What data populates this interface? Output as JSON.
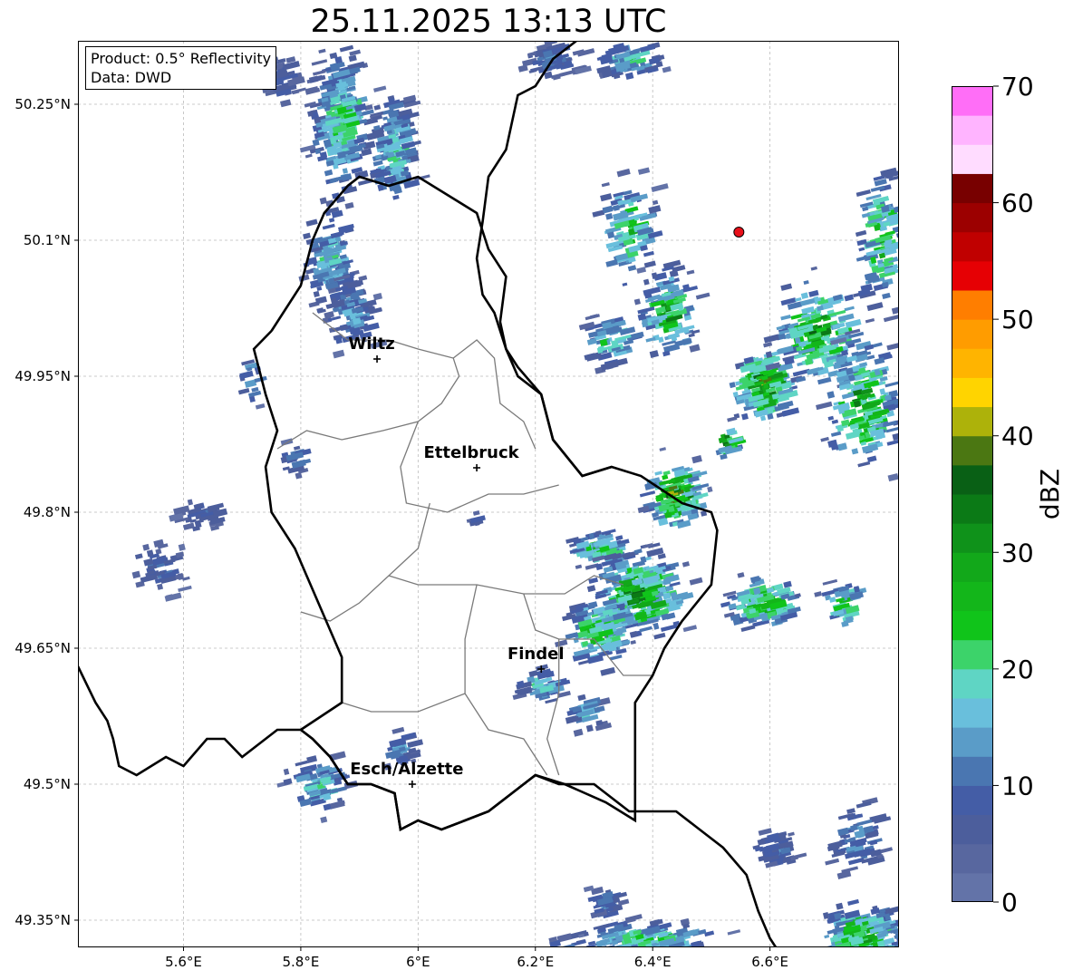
{
  "title": "25.11.2025 13:13 UTC",
  "info_box": {
    "product": "Product: 0.5° Reflectivity",
    "data": "Data: DWD"
  },
  "map": {
    "extent": {
      "lon": [
        5.42,
        6.82
      ],
      "lat": [
        49.32,
        50.32
      ]
    },
    "lat_ticks": [
      {
        "v": 49.35,
        "label": "49.35°N"
      },
      {
        "v": 49.5,
        "label": "49.5°N"
      },
      {
        "v": 49.65,
        "label": "49.65°N"
      },
      {
        "v": 49.8,
        "label": "49.8°N"
      },
      {
        "v": 49.95,
        "label": "49.95°N"
      },
      {
        "v": 50.1,
        "label": "50.1°N"
      },
      {
        "v": 50.25,
        "label": "50.25°N"
      }
    ],
    "lon_ticks": [
      {
        "v": 5.6,
        "label": "5.6°E"
      },
      {
        "v": 5.8,
        "label": "5.8°E"
      },
      {
        "v": 6.0,
        "label": "6°E"
      },
      {
        "v": 6.2,
        "label": "6.2°E"
      },
      {
        "v": 6.4,
        "label": "6.4°E"
      },
      {
        "v": 6.6,
        "label": "6.6°E"
      }
    ],
    "gridlines": true,
    "cities": [
      {
        "name": "Wiltz",
        "lon": 5.93,
        "lat": 49.969
      },
      {
        "name": "Ettelbruck",
        "lon": 6.1,
        "lat": 49.849
      },
      {
        "name": "Findel",
        "lon": 6.21,
        "lat": 49.627
      },
      {
        "name": "Esch/Alzette",
        "lon": 5.99,
        "lat": 49.5
      }
    ],
    "radar_site": {
      "lon": 6.547,
      "lat": 50.109,
      "color": "#e8101a"
    },
    "border": [
      [
        5.42,
        49.63
      ],
      [
        5.45,
        49.59
      ],
      [
        5.47,
        49.57
      ],
      [
        5.48,
        49.55
      ],
      [
        5.49,
        49.52
      ],
      [
        5.52,
        49.51
      ],
      [
        5.57,
        49.53
      ],
      [
        5.6,
        49.52
      ],
      [
        5.64,
        49.55
      ],
      [
        5.67,
        49.55
      ],
      [
        5.7,
        49.53
      ],
      [
        5.76,
        49.56
      ],
      [
        5.8,
        49.56
      ],
      [
        5.82,
        49.55
      ],
      [
        5.85,
        49.53
      ],
      [
        5.88,
        49.5
      ],
      [
        5.92,
        49.5
      ],
      [
        5.96,
        49.49
      ],
      [
        5.97,
        49.45
      ],
      [
        6.0,
        49.46
      ],
      [
        6.04,
        49.45
      ],
      [
        6.08,
        49.46
      ],
      [
        6.12,
        49.47
      ],
      [
        6.16,
        49.49
      ],
      [
        6.2,
        49.51
      ],
      [
        6.24,
        49.5
      ],
      [
        6.3,
        49.5
      ],
      [
        6.36,
        49.47
      ],
      [
        6.38,
        49.47
      ],
      [
        6.4,
        49.47
      ],
      [
        6.44,
        49.47
      ],
      [
        6.48,
        49.45
      ],
      [
        6.52,
        49.43
      ],
      [
        6.56,
        49.4
      ],
      [
        6.58,
        49.36
      ],
      [
        6.6,
        49.33
      ],
      [
        6.62,
        49.31
      ]
    ],
    "border_north": [
      [
        5.81,
        50.16
      ],
      [
        5.84,
        50.13
      ],
      [
        5.86,
        50.11
      ],
      [
        5.88,
        50.08
      ],
      [
        5.9,
        50.05
      ],
      [
        5.92,
        50.02
      ],
      [
        5.95,
        49.98
      ],
      [
        5.97,
        49.96
      ],
      [
        6.0,
        49.95
      ],
      [
        6.02,
        49.93
      ],
      [
        6.05,
        49.92
      ],
      [
        6.08,
        49.89
      ],
      [
        6.1,
        49.86
      ],
      [
        6.12,
        49.84
      ],
      [
        6.16,
        49.83
      ],
      [
        6.18,
        49.82
      ],
      [
        6.22,
        49.8
      ],
      [
        6.25,
        49.78
      ],
      [
        6.3,
        49.77
      ],
      [
        6.33,
        49.75
      ],
      [
        6.37,
        49.73
      ],
      [
        6.42,
        49.72
      ],
      [
        6.46,
        49.7
      ]
    ],
    "lux_outline": [
      [
        5.75,
        50.0
      ],
      [
        5.8,
        50.05
      ],
      [
        5.82,
        50.1
      ],
      [
        5.84,
        50.13
      ],
      [
        5.88,
        50.16
      ],
      [
        5.9,
        50.17
      ],
      [
        5.95,
        50.16
      ],
      [
        6.0,
        50.17
      ],
      [
        6.05,
        50.15
      ],
      [
        6.1,
        50.13
      ],
      [
        6.12,
        50.09
      ],
      [
        6.15,
        50.06
      ],
      [
        6.14,
        50.01
      ],
      [
        6.15,
        49.98
      ],
      [
        6.17,
        49.96
      ],
      [
        6.21,
        49.93
      ],
      [
        6.23,
        49.88
      ],
      [
        6.28,
        49.84
      ],
      [
        6.33,
        49.85
      ],
      [
        6.38,
        49.84
      ],
      [
        6.45,
        49.81
      ],
      [
        6.5,
        49.8
      ],
      [
        6.51,
        49.78
      ],
      [
        6.5,
        49.72
      ],
      [
        6.45,
        49.68
      ],
      [
        6.42,
        49.65
      ],
      [
        6.4,
        49.62
      ],
      [
        6.37,
        49.59
      ],
      [
        6.37,
        49.52
      ],
      [
        6.37,
        49.46
      ],
      [
        6.32,
        49.48
      ],
      [
        6.25,
        49.5
      ],
      [
        6.2,
        49.51
      ],
      [
        6.16,
        49.49
      ],
      [
        6.12,
        49.47
      ],
      [
        6.08,
        49.46
      ],
      [
        6.04,
        49.45
      ],
      [
        6.0,
        49.46
      ],
      [
        5.97,
        49.45
      ],
      [
        5.96,
        49.49
      ],
      [
        5.92,
        49.5
      ],
      [
        5.88,
        49.5
      ],
      [
        5.85,
        49.53
      ],
      [
        5.82,
        49.55
      ],
      [
        5.8,
        49.56
      ],
      [
        5.87,
        49.59
      ],
      [
        5.87,
        49.64
      ],
      [
        5.83,
        49.7
      ],
      [
        5.79,
        49.76
      ],
      [
        5.75,
        49.8
      ],
      [
        5.74,
        49.85
      ],
      [
        5.76,
        49.89
      ],
      [
        5.74,
        49.93
      ],
      [
        5.72,
        49.98
      ],
      [
        5.75,
        50.0
      ]
    ],
    "germany_west": [
      [
        6.27,
        50.32
      ],
      [
        6.23,
        50.3
      ],
      [
        6.2,
        50.27
      ],
      [
        6.17,
        50.26
      ],
      [
        6.16,
        50.23
      ],
      [
        6.15,
        50.2
      ],
      [
        6.12,
        50.17
      ],
      [
        6.11,
        50.12
      ],
      [
        6.1,
        50.08
      ],
      [
        6.11,
        50.04
      ],
      [
        6.13,
        50.02
      ],
      [
        6.15,
        49.98
      ],
      [
        6.17,
        49.95
      ],
      [
        6.21,
        49.93
      ],
      [
        6.23,
        49.88
      ],
      [
        6.28,
        49.84
      ],
      [
        6.33,
        49.85
      ]
    ],
    "cantons": [
      [
        [
          5.82,
          50.02
        ],
        [
          5.88,
          49.99
        ],
        [
          5.95,
          49.99
        ],
        [
          6.0,
          49.98
        ],
        [
          6.06,
          49.97
        ],
        [
          6.07,
          49.95
        ],
        [
          6.04,
          49.92
        ],
        [
          6.0,
          49.9
        ],
        [
          5.94,
          49.89
        ],
        [
          5.87,
          49.88
        ],
        [
          5.81,
          49.89
        ],
        [
          5.76,
          49.87
        ]
      ],
      [
        [
          6.06,
          49.97
        ],
        [
          6.1,
          49.99
        ],
        [
          6.13,
          49.97
        ],
        [
          6.14,
          49.92
        ],
        [
          6.18,
          49.9
        ],
        [
          6.2,
          49.87
        ]
      ],
      [
        [
          6.0,
          49.9
        ],
        [
          5.97,
          49.85
        ],
        [
          5.98,
          49.81
        ],
        [
          6.05,
          49.8
        ],
        [
          6.12,
          49.82
        ],
        [
          6.18,
          49.82
        ],
        [
          6.24,
          49.83
        ]
      ],
      [
        [
          6.02,
          49.81
        ],
        [
          6.0,
          49.76
        ],
        [
          5.95,
          49.73
        ],
        [
          5.9,
          49.7
        ],
        [
          5.85,
          49.68
        ],
        [
          5.8,
          49.69
        ]
      ],
      [
        [
          5.95,
          49.73
        ],
        [
          6.0,
          49.72
        ],
        [
          6.1,
          49.72
        ],
        [
          6.18,
          49.71
        ],
        [
          6.25,
          49.71
        ],
        [
          6.3,
          49.73
        ],
        [
          6.35,
          49.72
        ]
      ],
      [
        [
          6.1,
          49.72
        ],
        [
          6.08,
          49.66
        ],
        [
          6.08,
          49.6
        ],
        [
          6.12,
          49.56
        ],
        [
          6.18,
          49.55
        ],
        [
          6.22,
          49.51
        ]
      ],
      [
        [
          6.08,
          49.6
        ],
        [
          6.0,
          49.58
        ],
        [
          5.92,
          49.58
        ],
        [
          5.87,
          49.59
        ]
      ],
      [
        [
          6.18,
          49.71
        ],
        [
          6.2,
          49.67
        ],
        [
          6.24,
          49.66
        ],
        [
          6.3,
          49.66
        ],
        [
          6.35,
          49.62
        ],
        [
          6.4,
          49.62
        ]
      ],
      [
        [
          6.24,
          49.66
        ],
        [
          6.24,
          49.6
        ],
        [
          6.22,
          49.55
        ],
        [
          6.24,
          49.51
        ]
      ]
    ]
  },
  "colorbar": {
    "label": "dBZ",
    "min": 0,
    "max": 70,
    "ticks": [
      0,
      10,
      20,
      30,
      40,
      50,
      60,
      70
    ],
    "levels": [
      "#6373a8",
      "#58679f",
      "#4c5e9c",
      "#445da6",
      "#4a76b1",
      "#5a9cc8",
      "#69bfdc",
      "#5fd5c4",
      "#3cd36a",
      "#10c41a",
      "#13b61a",
      "#12a81a",
      "#0f921a",
      "#0b7a16",
      "#096015",
      "#4b7712",
      "#adb20a",
      "#ffd400",
      "#ffb400",
      "#ff9c00",
      "#ff7e00",
      "#e60004",
      "#c00000",
      "#9c0000",
      "#780000",
      "#ffdcff",
      "#ffb4ff",
      "#ff6ef7",
      "#eb34ea"
    ]
  }
}
